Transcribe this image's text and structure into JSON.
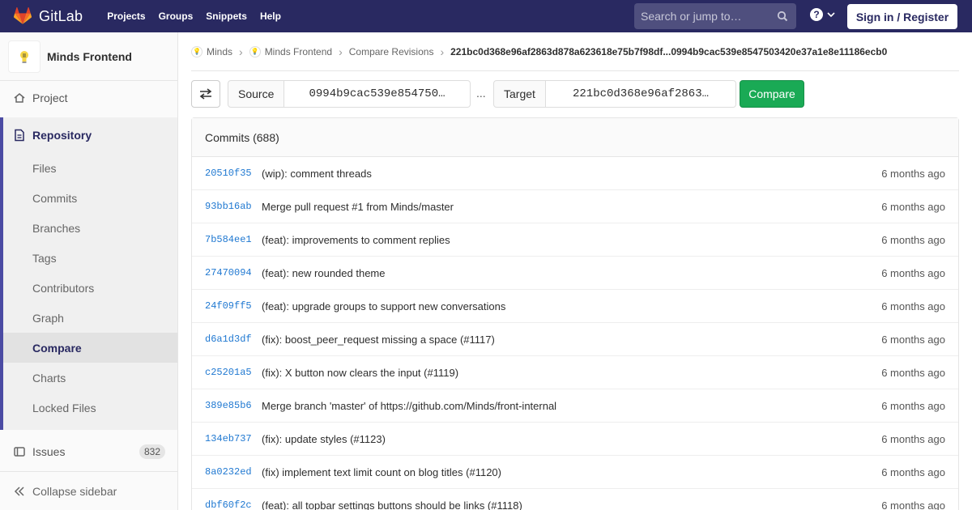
{
  "navbar": {
    "brand": "GitLab",
    "links": [
      "Projects",
      "Groups",
      "Snippets",
      "Help"
    ],
    "search_placeholder": "Search or jump to…",
    "sign_in": "Sign in / Register"
  },
  "sidebar": {
    "project_name": "Minds Frontend",
    "project": "Project",
    "repository": "Repository",
    "repo_items": [
      "Files",
      "Commits",
      "Branches",
      "Tags",
      "Contributors",
      "Graph",
      "Compare",
      "Charts",
      "Locked Files"
    ],
    "active_item": "Compare",
    "issues_label": "Issues",
    "issues_count": "832",
    "collapse": "Collapse sidebar"
  },
  "breadcrumb": {
    "items": [
      "Minds",
      "Minds Frontend",
      "Compare Revisions"
    ],
    "current": "221bc0d368e96af2863d878a623618e75b7f98df...0994b9cac539e8547503420e37a1e8e11186ecb0"
  },
  "compare": {
    "source_label": "Source",
    "source_value": "0994b9cac539e854750…",
    "dots": "...",
    "target_label": "Target",
    "target_value": "221bc0d368e96af2863…",
    "button": "Compare"
  },
  "commits": {
    "header": "Commits (688)",
    "rows": [
      {
        "sha": "20510f35",
        "msg": "(wip): comment threads",
        "time": "6 months ago"
      },
      {
        "sha": "93bb16ab",
        "msg": "Merge pull request #1 from Minds/master",
        "time": "6 months ago"
      },
      {
        "sha": "7b584ee1",
        "msg": "(feat): improvements to comment replies",
        "time": "6 months ago"
      },
      {
        "sha": "27470094",
        "msg": "(feat): new rounded theme",
        "time": "6 months ago"
      },
      {
        "sha": "24f09ff5",
        "msg": "(feat): upgrade groups to support new conversations",
        "time": "6 months ago"
      },
      {
        "sha": "d6a1d3df",
        "msg": "(fix): boost_peer_request missing a space (#1117)",
        "time": "6 months ago"
      },
      {
        "sha": "c25201a5",
        "msg": "(fix): X button now clears the input (#1119)",
        "time": "6 months ago"
      },
      {
        "sha": "389e85b6",
        "msg": "Merge branch 'master' of https://github.com/Minds/front-internal",
        "time": "6 months ago"
      },
      {
        "sha": "134eb737",
        "msg": "(fix): update styles (#1123)",
        "time": "6 months ago"
      },
      {
        "sha": "8a0232ed",
        "msg": "(fix) implement text limit count on blog titles (#1120)",
        "time": "6 months ago"
      },
      {
        "sha": "dbf60f2c",
        "msg": "(feat): all topbar settings buttons should be links (#1118)",
        "time": "6 months ago"
      }
    ]
  },
  "colors": {
    "navbar": "#292961",
    "accent": "#4b4ba3",
    "link": "#1f78d1",
    "success": "#1aaa55"
  }
}
